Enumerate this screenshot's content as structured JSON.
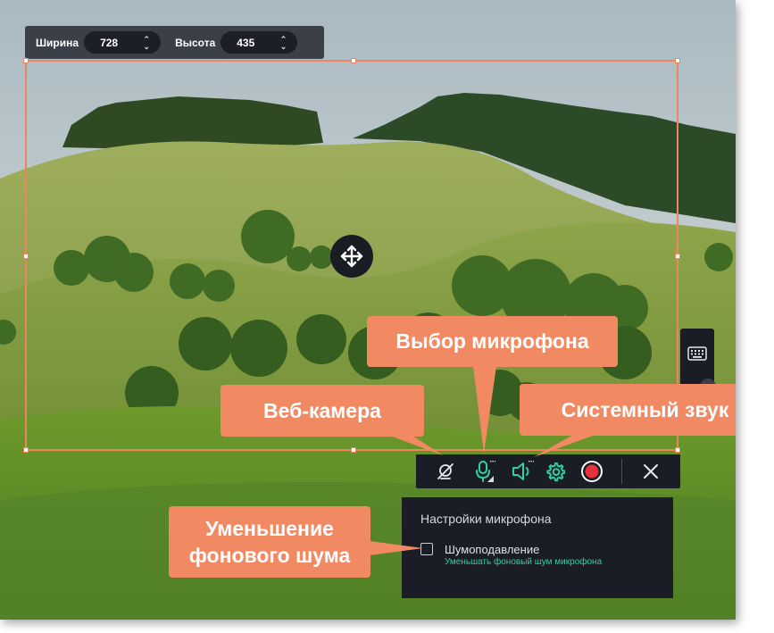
{
  "dimensions": {
    "width_label": "Ширина",
    "width_value": "728",
    "height_label": "Высота",
    "height_value": "435"
  },
  "toolbar": {
    "webcam_icon": "webcam-off-icon",
    "mic_icon": "microphone-icon",
    "system_audio_icon": "speaker-icon",
    "settings_icon": "gear-icon",
    "record_icon": "record-icon",
    "close_icon": "close-icon"
  },
  "sidebar": {
    "keyboard_icon": "keyboard-icon"
  },
  "mic_panel": {
    "title": "Настройки микрофона",
    "option_label": "Шумоподавление",
    "option_description": "Уменьшать фоновый шум микрофона",
    "option_checked": false
  },
  "callouts": {
    "microphone": "Выбор микрофона",
    "webcam": "Веб-камера",
    "system_audio": "Системный звук",
    "noise_line1": "Уменьшение",
    "noise_line2": "фонового шума"
  },
  "colors": {
    "accent": "#f18a63",
    "selection": "#f0845f",
    "teal": "#2ed0a8",
    "record": "#e8303a",
    "toolbar_bg": "#1a1c26"
  }
}
